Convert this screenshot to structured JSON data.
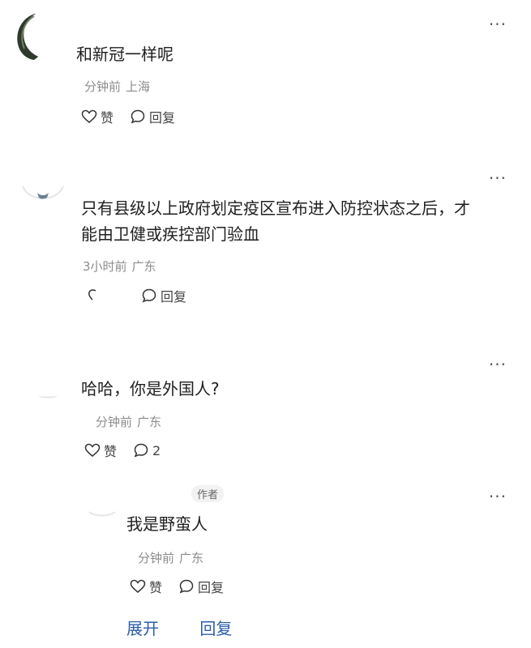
{
  "comments": [
    {
      "text": "和新冠一样呢",
      "time": "分钟前",
      "location": "上海",
      "like_label": "赞",
      "reply_label": "回复"
    },
    {
      "text_line1": "只有县级以上政府划定疫区宣布进入防控状态之后，才",
      "text_line2": "能由卫健或疾控部门验血",
      "time": "3小时前",
      "location": "广东",
      "reply_label": "回复"
    },
    {
      "text": "哈哈，你是外国人?",
      "time": "分钟前",
      "location": "广东",
      "like_label": "赞",
      "reply_count": "2"
    },
    {
      "author_badge": "作者",
      "text": "我是野蛮人",
      "time": "分钟前",
      "location": "广东",
      "like_label": "赞",
      "reply_label": "回复"
    }
  ],
  "footer": {
    "expand_label": "展开",
    "reply_label": "回复"
  },
  "more_label": "···",
  "icons": [
    "heart-icon",
    "comment-bubble-icon",
    "more-icon"
  ],
  "colors": {
    "link_blue": "#2b5ea8",
    "meta_gray": "#8c8c8c"
  }
}
